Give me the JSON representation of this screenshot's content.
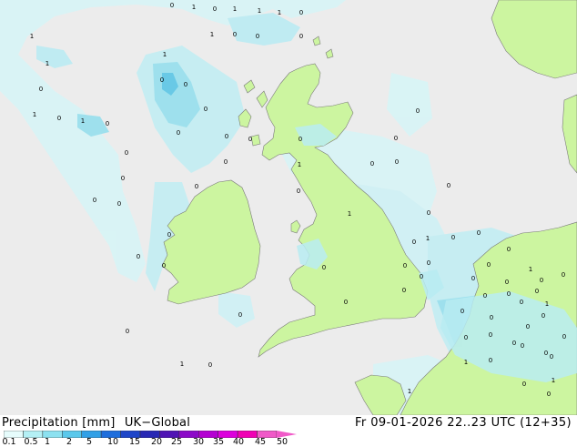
{
  "legend": {
    "title": "Precipitation [mm]",
    "model": "UK−Global",
    "ticks": [
      "0.1",
      "0.5",
      "1",
      "2",
      "5",
      "10",
      "15",
      "20",
      "25",
      "30",
      "35",
      "40",
      "45",
      "50"
    ],
    "colors": [
      "#e6fcfc",
      "#b4f0f5",
      "#8ce1f0",
      "#5ac8eb",
      "#32a0e6",
      "#1e6edc",
      "#1e46c8",
      "#2828b4",
      "#5014b4",
      "#8c0ac8",
      "#b400d2",
      "#dc00dc",
      "#f000b4",
      "#f05ac8"
    ]
  },
  "valid_time": "Fr 09-01-2026 22..23 UTC (12+35)",
  "colors": {
    "sea": "#ececec",
    "land": "#ccf5a0",
    "coast": "#7a7a7a",
    "precip_light": "#c8f0f5",
    "precip_mid": "#9ae0ee",
    "precip_heavy": "#62c8e6"
  },
  "point_values": [
    "0",
    "1",
    "0",
    "1",
    "1",
    "1",
    "0",
    "1",
    "0",
    "0",
    "0",
    "1",
    "1",
    "0",
    "1",
    "0",
    "0",
    "1",
    "0",
    "0",
    "0",
    "0",
    "1",
    "0",
    "0",
    "0",
    "0",
    "0",
    "0",
    "0",
    "0",
    "0",
    "1",
    "0",
    "0",
    "0",
    "0",
    "0",
    "0",
    "1",
    "0",
    "0",
    "0",
    "1",
    "0",
    "0",
    "0",
    "0",
    "0",
    "0",
    "0",
    "0",
    "0",
    "0",
    "0",
    "0",
    "1",
    "0",
    "0",
    "0",
    "1",
    "0",
    "0",
    "0",
    "0",
    "0",
    "0",
    "0",
    "0",
    "0",
    "0",
    "0",
    "0",
    "0",
    "1",
    "0",
    "1",
    "0",
    "0",
    "1",
    "0",
    "0",
    "1",
    "0",
    "0",
    "0",
    "0"
  ]
}
